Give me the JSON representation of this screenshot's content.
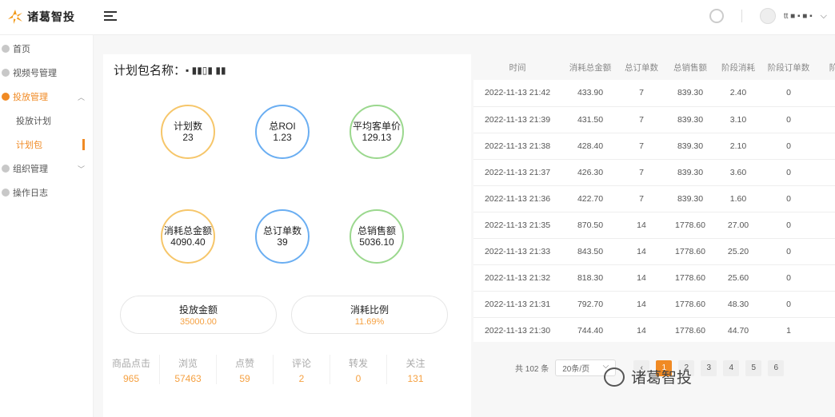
{
  "app": {
    "name": "诸葛智投"
  },
  "header": {
    "user_name": "tt ■ ▪ ■ ▪"
  },
  "sidebar": {
    "items": [
      {
        "label": "首页"
      },
      {
        "label": "视频号管理"
      },
      {
        "label": "投放管理"
      },
      {
        "label": "投放计划"
      },
      {
        "label": "计划包"
      },
      {
        "label": "组织管理"
      },
      {
        "label": "操作日志"
      }
    ]
  },
  "package": {
    "title_label": "计划包名称：",
    "name": "▪ ▮▮▯▮ ▮▮"
  },
  "metrics": [
    {
      "label": "计划数",
      "value": "23",
      "color": "#f6c66a"
    },
    {
      "label": "总ROI",
      "value": "1.23",
      "color": "#6aaef2"
    },
    {
      "label": "平均客单价",
      "value": "129.13",
      "color": "#9bd88e"
    },
    {
      "label": "消耗总金额",
      "value": "4090.40",
      "color": "#f6c66a"
    },
    {
      "label": "总订单数",
      "value": "39",
      "color": "#6aaef2"
    },
    {
      "label": "总销售额",
      "value": "5036.10",
      "color": "#9bd88e"
    }
  ],
  "pills": [
    {
      "label": "投放金额",
      "value": "35000.00"
    },
    {
      "label": "消耗比例",
      "value": "11.69%"
    }
  ],
  "stats": [
    {
      "label": "商品点击",
      "value": "965"
    },
    {
      "label": "浏览",
      "value": "57463"
    },
    {
      "label": "点赞",
      "value": "59"
    },
    {
      "label": "评论",
      "value": "2"
    },
    {
      "label": "转发",
      "value": "0"
    },
    {
      "label": "关注",
      "value": "131"
    }
  ],
  "table": {
    "columns": [
      "时间",
      "消耗总金额",
      "总订单数",
      "总销售额",
      "阶段消耗",
      "阶段订单数",
      "阶"
    ],
    "rows": [
      [
        "2022-11-13 21:42",
        "433.90",
        "7",
        "839.30",
        "2.40",
        "0"
      ],
      [
        "2022-11-13 21:39",
        "431.50",
        "7",
        "839.30",
        "3.10",
        "0"
      ],
      [
        "2022-11-13 21:38",
        "428.40",
        "7",
        "839.30",
        "2.10",
        "0"
      ],
      [
        "2022-11-13 21:37",
        "426.30",
        "7",
        "839.30",
        "3.60",
        "0"
      ],
      [
        "2022-11-13 21:36",
        "422.70",
        "7",
        "839.30",
        "1.60",
        "0"
      ],
      [
        "2022-11-13 21:35",
        "870.50",
        "14",
        "1778.60",
        "27.00",
        "0"
      ],
      [
        "2022-11-13 21:33",
        "843.50",
        "14",
        "1778.60",
        "25.20",
        "0"
      ],
      [
        "2022-11-13 21:32",
        "818.30",
        "14",
        "1778.60",
        "25.60",
        "0"
      ],
      [
        "2022-11-13 21:31",
        "792.70",
        "14",
        "1778.60",
        "48.30",
        "0"
      ],
      [
        "2022-11-13 21:30",
        "744.40",
        "14",
        "1778.60",
        "44.70",
        "1"
      ]
    ]
  },
  "pagination": {
    "total_label": "共 102 条",
    "page_size": "20条/页",
    "pages": [
      "1",
      "2",
      "3",
      "4",
      "5",
      "6"
    ],
    "current": "1"
  },
  "watermark": {
    "text": "诸葛智投"
  }
}
